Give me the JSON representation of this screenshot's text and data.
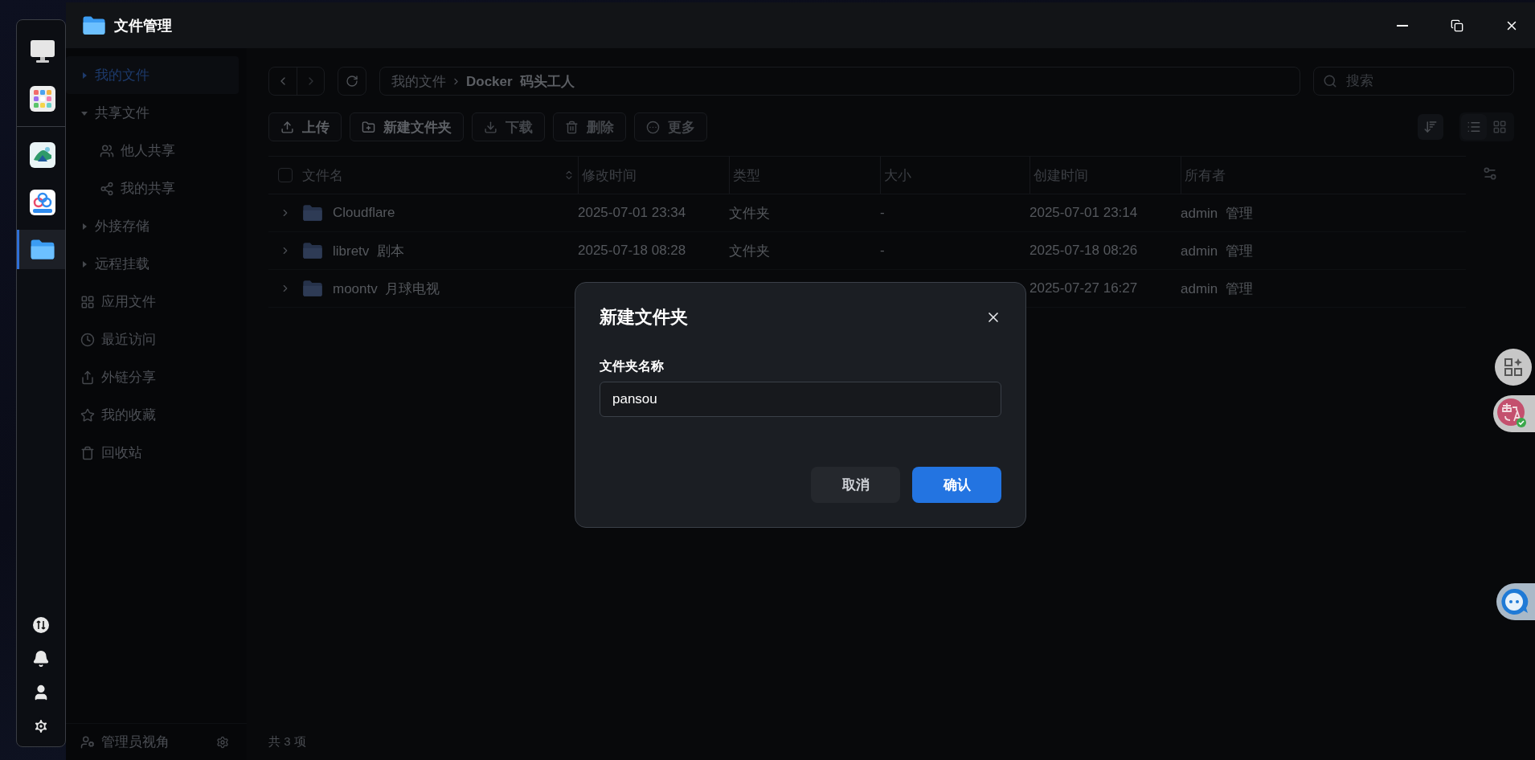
{
  "window": {
    "title": "文件管理"
  },
  "dock": {
    "apps": [
      {
        "kind": "monitor",
        "selected": false
      },
      {
        "kind": "app-grid",
        "selected": false
      },
      {
        "kind": "landscape",
        "selected": false
      },
      {
        "kind": "cloud",
        "selected": false
      },
      {
        "kind": "folder",
        "selected": true
      }
    ],
    "tools": [
      {
        "kind": "transfer"
      },
      {
        "kind": "bell"
      },
      {
        "kind": "user"
      },
      {
        "kind": "gear"
      }
    ]
  },
  "sidebar": {
    "items": [
      {
        "label": "我的文件",
        "kind": "tree",
        "expanded": false,
        "selected": true
      },
      {
        "label": "共享文件",
        "kind": "tree",
        "expanded": true,
        "selected": false,
        "children": [
          {
            "label": "他人共享",
            "kind": "users",
            "selected": false
          },
          {
            "label": "我的共享",
            "kind": "share-nodes",
            "selected": false
          }
        ]
      },
      {
        "label": "外接存储",
        "kind": "tree",
        "expanded": false,
        "selected": false
      },
      {
        "label": "远程挂载",
        "kind": "tree",
        "expanded": false,
        "selected": false
      },
      {
        "label": "应用文件",
        "kind": "apps",
        "selected": false
      },
      {
        "label": "最近访问",
        "kind": "clock",
        "selected": false
      },
      {
        "label": "外链分享",
        "kind": "external",
        "selected": false
      },
      {
        "label": "我的收藏",
        "kind": "star",
        "selected": false
      },
      {
        "label": "回收站",
        "kind": "trash",
        "selected": false
      }
    ],
    "footer": {
      "label": "管理员视角"
    }
  },
  "breadcrumb": [
    {
      "label": "我的文件",
      "current": false
    },
    {
      "label": "Docker  码头工人",
      "current": true
    }
  ],
  "search": {
    "placeholder": "搜索"
  },
  "actions": [
    {
      "label": "上传",
      "kind": "upload",
      "disabled": false
    },
    {
      "label": "新建文件夹",
      "kind": "new-folder",
      "disabled": false
    },
    {
      "label": "下载",
      "kind": "download",
      "disabled": true
    },
    {
      "label": "删除",
      "kind": "delete",
      "disabled": true
    },
    {
      "label": "更多",
      "kind": "more",
      "disabled": true
    }
  ],
  "view": [
    {
      "kind": "list",
      "selected": true
    },
    {
      "kind": "grid",
      "selected": false
    }
  ],
  "table": {
    "select_all": {
      "checked": false
    },
    "columns": [
      "文件名",
      "修改时间",
      "类型",
      "大小",
      "创建时间",
      "所有者"
    ],
    "rows": [
      {
        "name": "Cloudflare",
        "modified": "2025-07-01 23:34",
        "type": "文件夹",
        "size": "-",
        "created": "2025-07-01 23:14",
        "owner": "admin  管理"
      },
      {
        "name": "libretv  剧本",
        "modified": "2025-07-18 08:28",
        "type": "文件夹",
        "size": "-",
        "created": "2025-07-18 08:26",
        "owner": "admin  管理"
      },
      {
        "name": "moontv  月球电视",
        "created": "2025-07-27 16:27",
        "owner": "admin  管理"
      }
    ]
  },
  "status_bar": {
    "count": "共 3 项"
  },
  "dialog": {
    "title": "新建文件夹",
    "field_label": "文件夹名称",
    "value": "pansou",
    "buttons": [
      {
        "label": "取消",
        "kind": "cancel"
      },
      {
        "label": "确认",
        "kind": "confirm"
      }
    ]
  }
}
